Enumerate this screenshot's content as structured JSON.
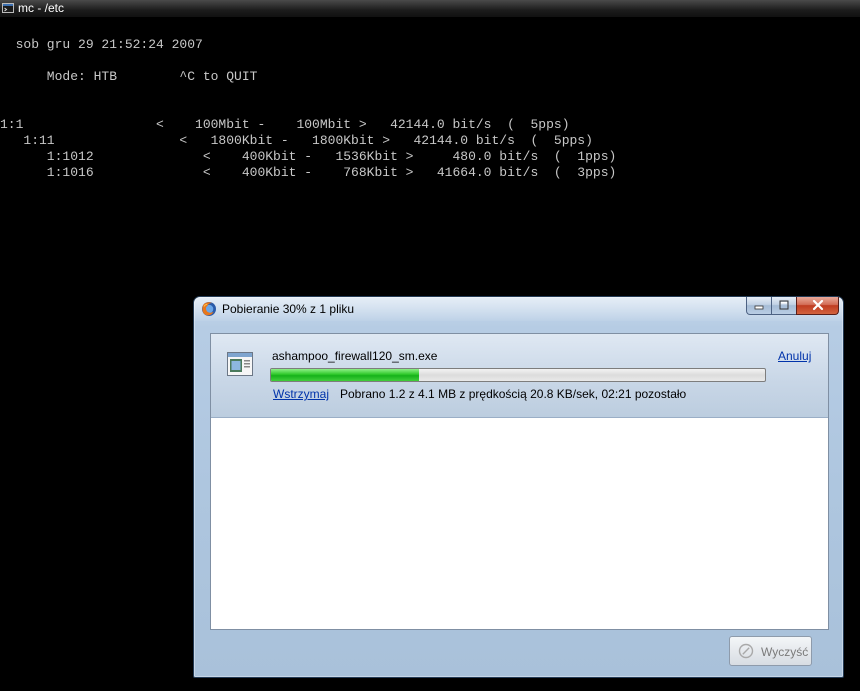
{
  "console": {
    "title": "mc - /etc",
    "lines": [
      "  sob gru 29 21:52:24 2007",
      "      Mode: HTB        ^C to QUIT",
      "1:1                 <    100Mbit -    100Mbit >   42144.0 bit/s  (  5pps)",
      "   1:11                <   1800Kbit -   1800Kbit >   42144.0 bit/s  (  5pps)",
      "      1:1012              <    400Kbit -   1536Kbit >     480.0 bit/s  (  1pps)",
      "      1:1016              <    400Kbit -    768Kbit >   41664.0 bit/s  (  3pps)"
    ]
  },
  "dialog": {
    "title": "Pobieranie 30% z 1 pliku",
    "icon": "firefox-icon",
    "controls": [
      "minimize-icon",
      "maximize-icon",
      "close-icon"
    ],
    "download": {
      "file_name": "ashampoo_firewall120_sm.exe",
      "progress_percent": 30,
      "cancel_label": "Anuluj",
      "pause_label": "Wstrzymaj",
      "status": "Pobrano 1.2 z 4.1 MB z prędkością 20.8 KB/sek, 02:21 pozostało"
    },
    "clear_button_label": "Wyczyść"
  },
  "colors": {
    "console_bg": "#000000",
    "console_text": "#c8c8c8",
    "progress_fill": "#2ec82a",
    "link": "#0033aa",
    "close_button": "#c8462b"
  }
}
